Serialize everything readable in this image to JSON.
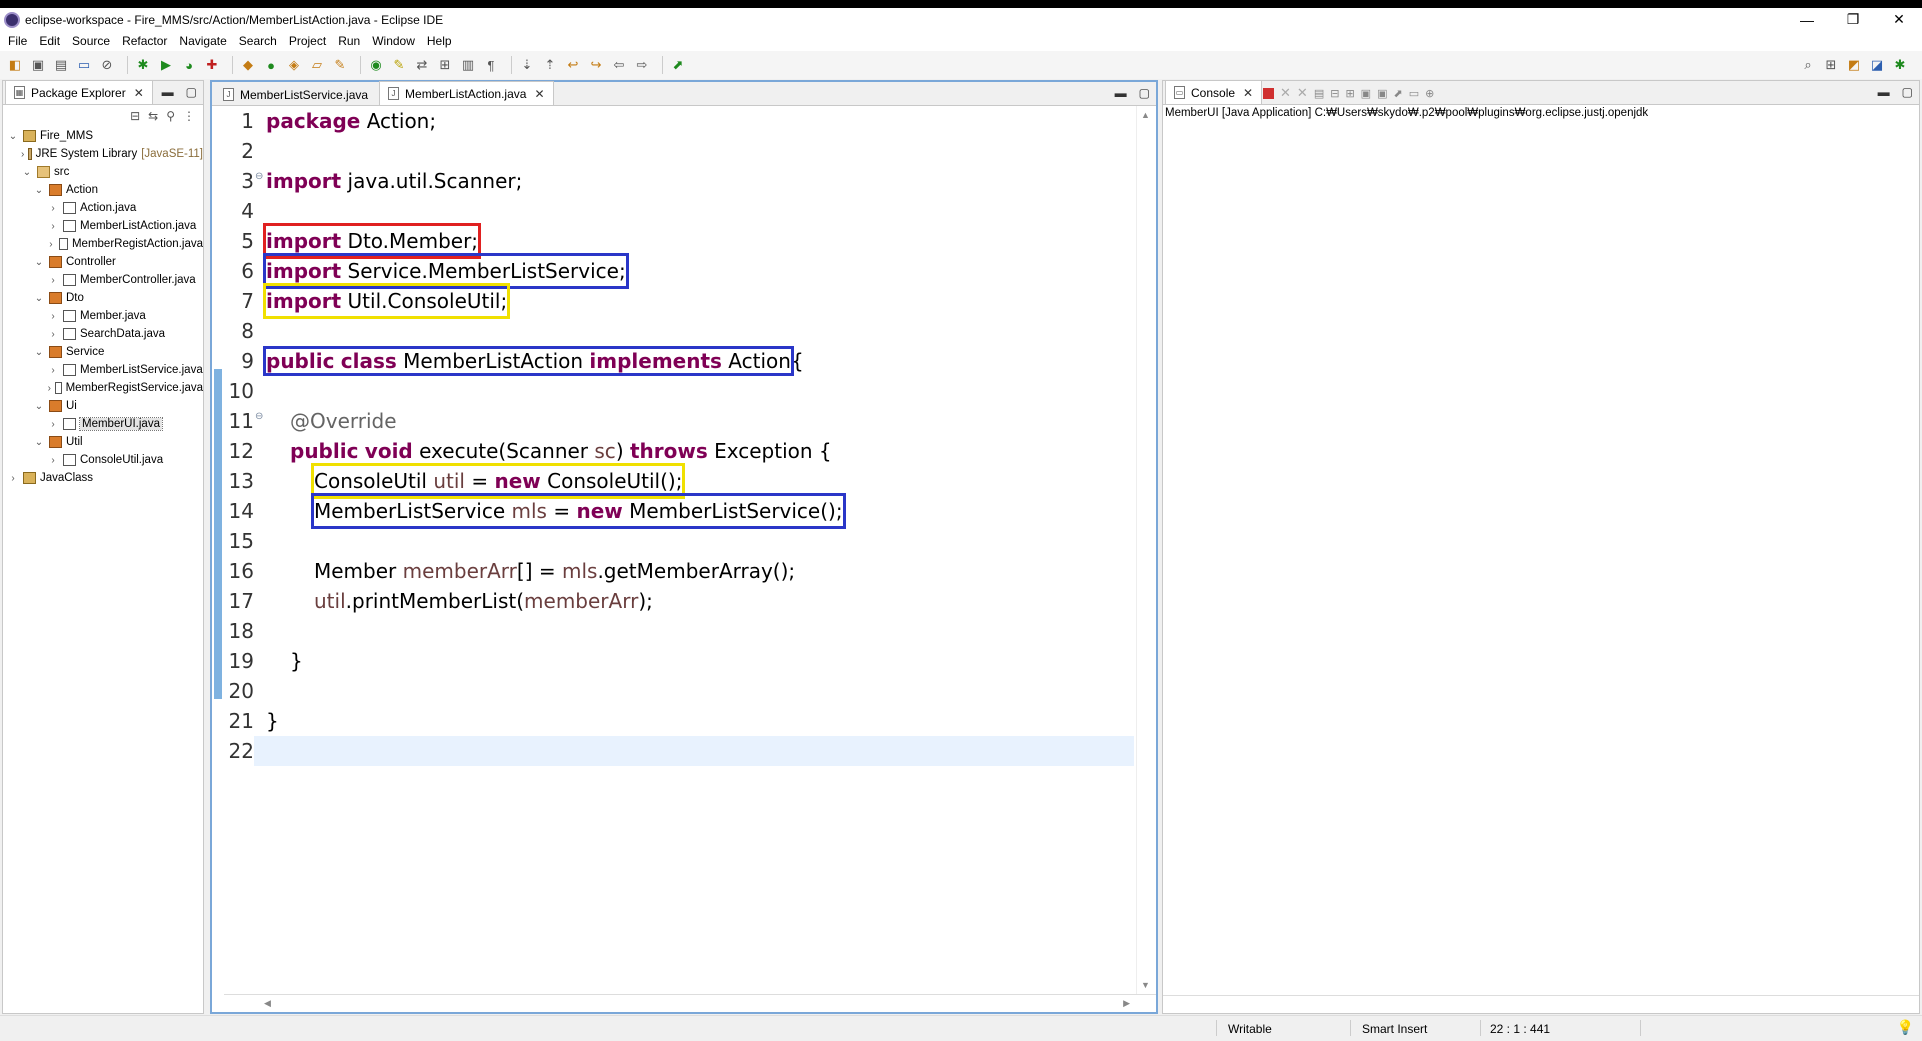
{
  "window": {
    "title": "eclipse-workspace - Fire_MMS/src/Action/MemberListAction.java - Eclipse IDE",
    "minimize": "—",
    "maximize": "❐",
    "close": "✕"
  },
  "menu": [
    "File",
    "Edit",
    "Source",
    "Refactor",
    "Navigate",
    "Search",
    "Project",
    "Run",
    "Window",
    "Help"
  ],
  "package_explorer": {
    "tab_label": "Package Explorer",
    "tree": [
      {
        "label": "Fire_MMS",
        "icon": "project-icon"
      },
      {
        "label": "JRE System Library",
        "decoration": "[JavaSE-11]",
        "icon": "library-icon"
      },
      {
        "label": "src",
        "icon": "source-folder-icon"
      },
      {
        "label": "Action",
        "icon": "package-icon"
      },
      {
        "label": "Action.java",
        "icon": "java-file-icon"
      },
      {
        "label": "MemberListAction.java",
        "icon": "java-file-icon"
      },
      {
        "label": "MemberRegistAction.java",
        "icon": "java-file-icon"
      },
      {
        "label": "Controller",
        "icon": "package-icon"
      },
      {
        "label": "MemberController.java",
        "icon": "java-file-icon"
      },
      {
        "label": "Dto",
        "icon": "package-icon"
      },
      {
        "label": "Member.java",
        "icon": "java-file-icon"
      },
      {
        "label": "SearchData.java",
        "icon": "java-file-icon"
      },
      {
        "label": "Service",
        "icon": "package-icon"
      },
      {
        "label": "MemberListService.java",
        "icon": "java-file-icon"
      },
      {
        "label": "MemberRegistService.java",
        "icon": "java-file-icon"
      },
      {
        "label": "Ui",
        "icon": "package-icon"
      },
      {
        "label": "MemberUI.java",
        "icon": "java-file-icon"
      },
      {
        "label": "Util",
        "icon": "package-icon"
      },
      {
        "label": "ConsoleUtil.java",
        "icon": "java-file-icon"
      },
      {
        "label": "JavaClass",
        "icon": "project-icon"
      }
    ]
  },
  "editor": {
    "tabs": [
      {
        "label": "MemberListService.java"
      },
      {
        "label": "MemberListAction.java"
      }
    ],
    "lines": [
      {
        "n": "1",
        "code": "package Action;"
      },
      {
        "n": "2",
        "code": ""
      },
      {
        "n": "3",
        "code": "import java.util.Scanner;"
      },
      {
        "n": "4",
        "code": ""
      },
      {
        "n": "5",
        "code": "import Dto.Member;"
      },
      {
        "n": "6",
        "code": "import Service.MemberListService;"
      },
      {
        "n": "7",
        "code": "import Util.ConsoleUtil;"
      },
      {
        "n": "8",
        "code": ""
      },
      {
        "n": "9",
        "code": "public class MemberListAction implements Action {"
      },
      {
        "n": "10",
        "code": ""
      },
      {
        "n": "11",
        "code": "@Override"
      },
      {
        "n": "12",
        "code": "public void execute(Scanner sc) throws Exception {"
      },
      {
        "n": "13",
        "code": "ConsoleUtil util = new ConsoleUtil();"
      },
      {
        "n": "14",
        "code": "MemberListService mls = new MemberListService();"
      },
      {
        "n": "15",
        "code": ""
      },
      {
        "n": "16",
        "code": "Member memberArr[] = mls.getMemberArray();"
      },
      {
        "n": "17",
        "code": "util.printMemberList(memberArr);"
      },
      {
        "n": "18",
        "code": ""
      },
      {
        "n": "19",
        "code": "}"
      },
      {
        "n": "20",
        "code": ""
      },
      {
        "n": "21",
        "code": "}"
      },
      {
        "n": "22",
        "code": ""
      }
    ],
    "tokens": {
      "package": "package",
      "Action_semi": " Action;",
      "import": "import",
      "java_util_Scanner": " java.util.Scanner;",
      "Dto_Member": " Dto.Member;",
      "Service_MLS": " Service.MemberListService;",
      "Util_CU": " Util.ConsoleUtil;",
      "public": "public",
      "class": "class",
      "MemberListAction": " MemberListAction ",
      "implements": "implements",
      "Action": " Action",
      "brace_open": "{",
      "Override": "@Override",
      "void": "void",
      "execute": " execute(Scanner ",
      "sc": "sc",
      "paren_close": ") ",
      "throws": "throws",
      "Exception": " Exception {",
      "ConsoleUtil": "ConsoleUtil ",
      "util": "util",
      "eq": " = ",
      "new": "new",
      "ConsoleUtil_call": " ConsoleUtil();",
      "MemberListService": "MemberListService ",
      "mls": "mls",
      "MLS_call": " MemberListService();",
      "Member": "Member ",
      "memberArr": "memberArr",
      "arr_assign": "[] = ",
      "getMemberArray": ".getMemberArray();",
      "printMemberList": ".printMemberList(",
      "close_call": ");",
      "brace_close": "}"
    }
  },
  "console": {
    "tab_label": "Console",
    "launch": "MemberUI [Java Application] C:₩Users₩skydo₩.p2₩pool₩plugins₩org.eclipse.justj.openjdk"
  },
  "status": {
    "writable": "Writable",
    "insert_mode": "Smart Insert",
    "position": "22 : 1 : 441"
  },
  "colors": {
    "keyword": "#7f0055",
    "annotation": "#646464",
    "local_var": "#6a3e3e",
    "box_red": "#e02020",
    "box_blue": "#2a36c8",
    "box_yellow": "#f0e000"
  }
}
